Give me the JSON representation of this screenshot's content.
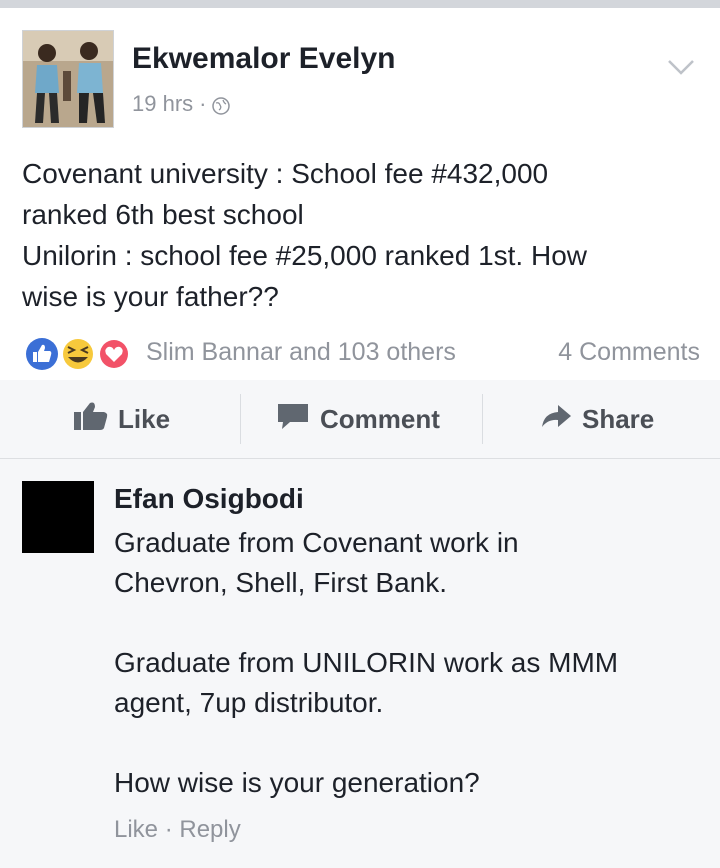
{
  "post": {
    "author": "Ekwemalor Evelyn",
    "time": "19 hrs",
    "separator": "·",
    "privacy_icon": "globe-icon",
    "text_lines": [
      "Covenant university : School fee #432,000",
      "ranked 6th best school",
      "Unilorin : school fee #25,000 ranked 1st. How",
      "wise is your father??"
    ],
    "reactions": [
      "like",
      "haha",
      "love"
    ],
    "reactions_text": "Slim Bannar and 103 others",
    "comments_count": "4 Comments"
  },
  "actions": {
    "like": "Like",
    "comment": "Comment",
    "share": "Share"
  },
  "comment": {
    "author": "Efan Osigbodi",
    "lines": [
      "Graduate from Covenant work in",
      "Chevron, Shell, First Bank.",
      "",
      "Graduate from UNILORIN work as MMM",
      "agent, 7up distributor.",
      "",
      "How wise is your generation?"
    ],
    "like_label": "Like",
    "separator": "·",
    "reply_label": "Reply"
  },
  "colors": {
    "like_blue": "#3b5998",
    "love_red": "#f25268",
    "haha_yellow": "#f7c93c",
    "muted": "#90949c"
  }
}
